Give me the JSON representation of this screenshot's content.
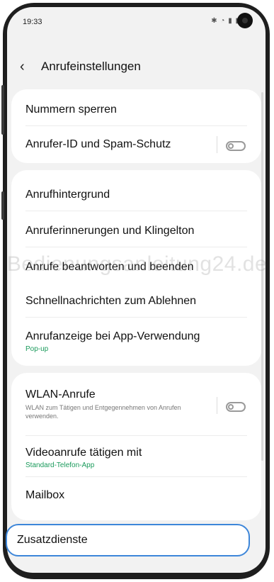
{
  "status_bar": {
    "time": "19:33",
    "icons": "✱ ◔ ▮ ▮"
  },
  "header": {
    "back_icon": "chevron-left-icon",
    "title": "Anrufeinstellungen"
  },
  "group1": {
    "items": [
      {
        "label": "Nummern sperren"
      },
      {
        "label": "Anrufer-ID und Spam-Schutz",
        "toggle": "off"
      }
    ]
  },
  "group2": {
    "items": [
      {
        "label": "Anrufhintergrund"
      },
      {
        "label": "Anruferinnerungen und Klingelton"
      },
      {
        "label": "Anrufe beantworten und beenden"
      },
      {
        "label": "Schnellnachrichten zum Ablehnen"
      },
      {
        "label": "Anrufanzeige bei App-Verwendung",
        "sub": "Pop-up"
      }
    ]
  },
  "group3": {
    "items": [
      {
        "label": "WLAN-Anrufe",
        "desc": "WLAN zum Tätigen und Entgegennehmen von Anrufen verwenden.",
        "toggle": "off"
      },
      {
        "label": "Videoanrufe tätigen mit",
        "sub": "Standard-Telefon-App"
      },
      {
        "label": "Mailbox"
      }
    ]
  },
  "focused_item": {
    "label": "Zusatzdienste"
  },
  "watermark": "Bedienungsanleitung24.de",
  "colors": {
    "accent_green": "#1a9a5b",
    "focus_blue": "#3d86d9",
    "background": "#f2f2f2"
  }
}
